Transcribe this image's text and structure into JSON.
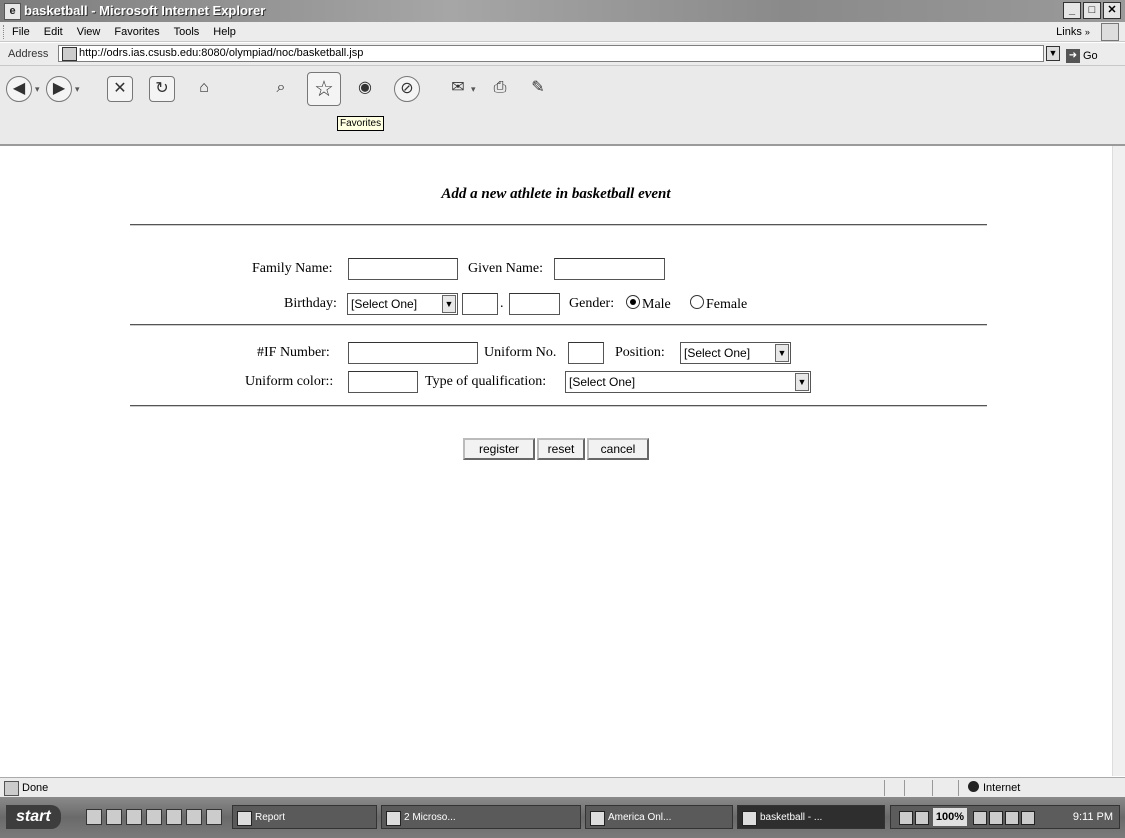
{
  "window": {
    "title": "basketball - Microsoft Internet Explorer",
    "buttons": {
      "minimize": "_",
      "maximize": "□",
      "close": "✕"
    }
  },
  "menu": {
    "items": [
      "File",
      "Edit",
      "View",
      "Favorites",
      "Tools",
      "Help"
    ],
    "links_label": "Links"
  },
  "address": {
    "label": "Address",
    "url": "http://odrs.ias.csusb.edu:8080/olympiad/noc/basketball.jsp",
    "go_label": "Go"
  },
  "toolbar": {
    "tooltip": "Favorites"
  },
  "page": {
    "title": "Add a new athlete in basketball event",
    "family_name_label": "Family Name:",
    "given_name_label": "Given Name:",
    "birthday_label": "Birthday:",
    "birthday_select": "[Select One]",
    "birthday_sep": ".",
    "gender_label": "Gender:",
    "gender_male": "Male",
    "gender_female": "Female",
    "if_number_label": "#IF Number:",
    "uniform_no_label": "Uniform No.",
    "position_label": "Position:",
    "position_select": "[Select One]",
    "uniform_color_label": "Uniform color::",
    "qualification_label": "Type of qualification:",
    "qualification_select": "[Select One]",
    "register_label": "register",
    "reset_label": "reset",
    "cancel_label": "cancel"
  },
  "status": {
    "text": "Done",
    "zone": "Internet"
  },
  "taskbar": {
    "start_label": "start",
    "tasks": [
      "Report",
      "2 Microso...",
      "America Onl...",
      "basketball - ..."
    ],
    "zoom": "100%",
    "clock": "9:11 PM"
  },
  "colors": {
    "page_bg": "#ffffff",
    "chrome": "#ececec",
    "title_text": "#ffffff"
  }
}
